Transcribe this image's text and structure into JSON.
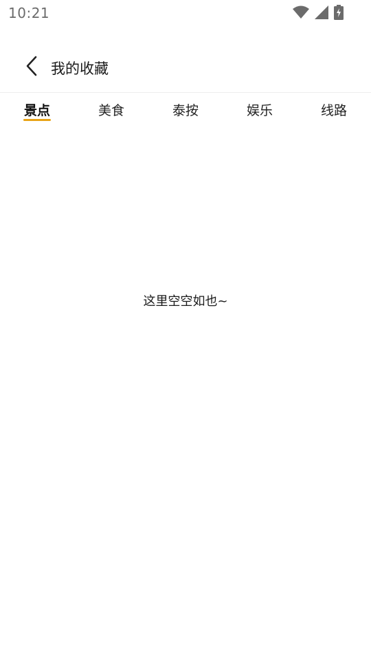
{
  "status_bar": {
    "time": "10:21",
    "icons": [
      "wifi-icon",
      "signal-icon",
      "battery-charging-icon"
    ]
  },
  "header": {
    "title": "我的收藏",
    "back_icon": "chevron-left-icon"
  },
  "tabs": [
    {
      "label": "景点",
      "active": true
    },
    {
      "label": "美食",
      "active": false
    },
    {
      "label": "泰按",
      "active": false
    },
    {
      "label": "娱乐",
      "active": false
    },
    {
      "label": "线路",
      "active": false
    }
  ],
  "empty_state": {
    "message": "这里空空如也~"
  },
  "colors": {
    "accent": "#E8A317",
    "status_icon": "#6b6b6b"
  }
}
